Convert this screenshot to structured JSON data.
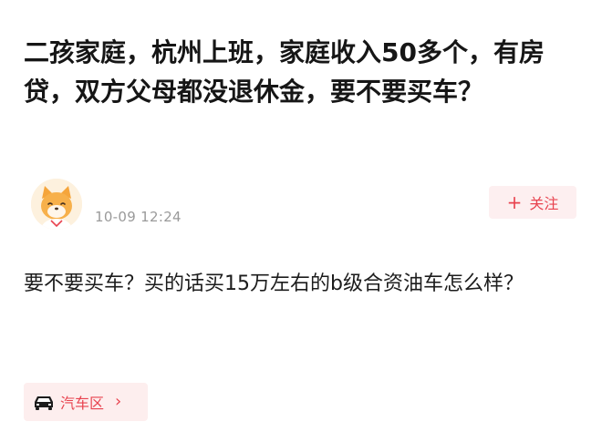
{
  "post": {
    "title": "二孩家庭，杭州上班，家庭收入50多个，有房贷，双方父母都没退休金，要不要买车？",
    "timestamp": "10-09 12:24",
    "follow_label": "关注",
    "follow_icon": "plus-icon",
    "body": "要不要买车？买的话买15万左右的b级合资油车怎么样？"
  },
  "topic_tag": {
    "icon": "car-icon",
    "label": "汽车区",
    "chevron": "›"
  },
  "colors": {
    "accent": "#e8434f",
    "accent_bg": "#fdeff0",
    "muted_text": "#9a9a9a",
    "title_text": "#161616"
  }
}
